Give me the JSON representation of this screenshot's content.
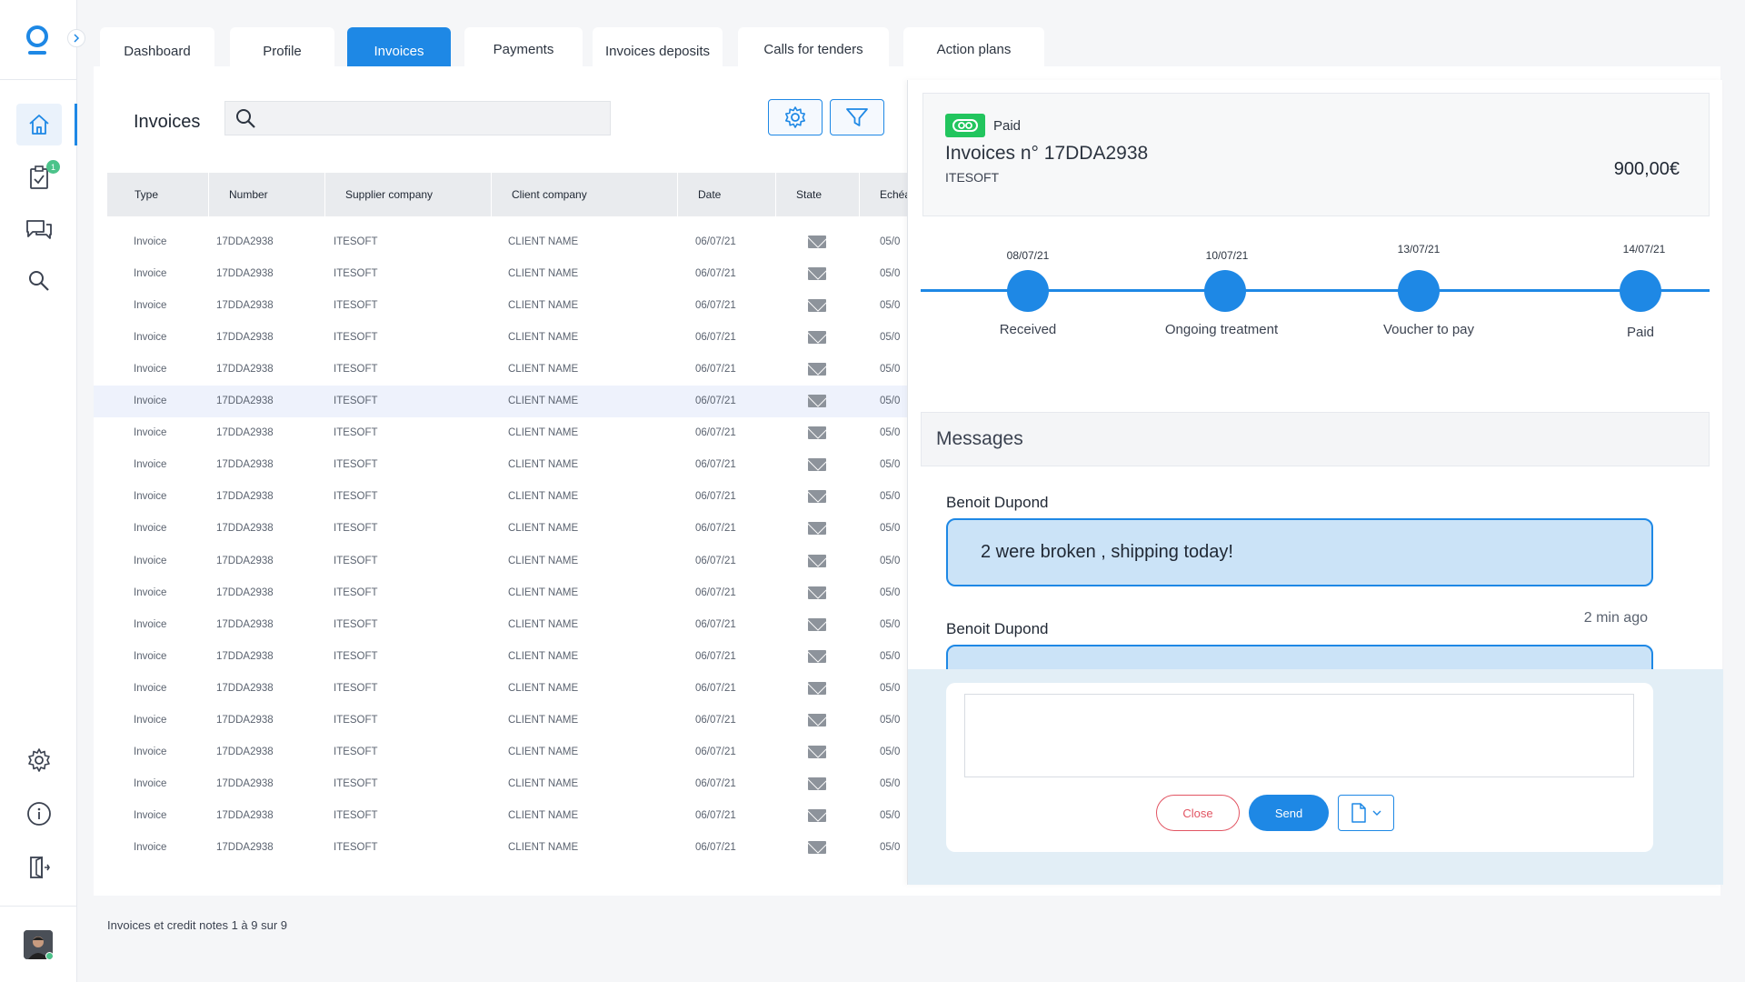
{
  "sidebar": {
    "badge_count": "1",
    "accent": "#1e88e5"
  },
  "tabs": [
    {
      "label": "Dashboard"
    },
    {
      "label": "Profile"
    },
    {
      "label": "Invoices"
    },
    {
      "label": "Payments"
    },
    {
      "label": "Invoices deposits"
    },
    {
      "label": "Calls for tenders"
    },
    {
      "label": "Action plans"
    }
  ],
  "main": {
    "title": "Invoices",
    "search_placeholder": "",
    "footer": "Invoices et credit notes 1 à 9 sur 9"
  },
  "table": {
    "columns": [
      "Type",
      "Number",
      "Supplier company",
      "Client company",
      "Date",
      "State",
      "Echéa"
    ],
    "selected_row": 5,
    "rows": [
      {
        "type": "Invoice",
        "number": "17DDA2938",
        "supplier": "ITESOFT",
        "client": "CLIENT NAME",
        "date": "06/07/21",
        "due": "05/0"
      },
      {
        "type": "Invoice",
        "number": "17DDA2938",
        "supplier": "ITESOFT",
        "client": "CLIENT NAME",
        "date": "06/07/21",
        "due": "05/0"
      },
      {
        "type": "Invoice",
        "number": "17DDA2938",
        "supplier": "ITESOFT",
        "client": "CLIENT NAME",
        "date": "06/07/21",
        "due": "05/0"
      },
      {
        "type": "Invoice",
        "number": "17DDA2938",
        "supplier": "ITESOFT",
        "client": "CLIENT NAME",
        "date": "06/07/21",
        "due": "05/0"
      },
      {
        "type": "Invoice",
        "number": "17DDA2938",
        "supplier": "ITESOFT",
        "client": "CLIENT NAME",
        "date": "06/07/21",
        "due": "05/0"
      },
      {
        "type": "Invoice",
        "number": "17DDA2938",
        "supplier": "ITESOFT",
        "client": "CLIENT NAME",
        "date": "06/07/21",
        "due": "05/0"
      },
      {
        "type": "Invoice",
        "number": "17DDA2938",
        "supplier": "ITESOFT",
        "client": "CLIENT NAME",
        "date": "06/07/21",
        "due": "05/0"
      },
      {
        "type": "Invoice",
        "number": "17DDA2938",
        "supplier": "ITESOFT",
        "client": "CLIENT NAME",
        "date": "06/07/21",
        "due": "05/0"
      },
      {
        "type": "Invoice",
        "number": "17DDA2938",
        "supplier": "ITESOFT",
        "client": "CLIENT NAME",
        "date": "06/07/21",
        "due": "05/0"
      },
      {
        "type": "Invoice",
        "number": "17DDA2938",
        "supplier": "ITESOFT",
        "client": "CLIENT NAME",
        "date": "06/07/21",
        "due": "05/0"
      },
      {
        "type": "Invoice",
        "number": "17DDA2938",
        "supplier": "ITESOFT",
        "client": "CLIENT NAME",
        "date": "06/07/21",
        "due": "05/0"
      },
      {
        "type": "Invoice",
        "number": "17DDA2938",
        "supplier": "ITESOFT",
        "client": "CLIENT NAME",
        "date": "06/07/21",
        "due": "05/0"
      },
      {
        "type": "Invoice",
        "number": "17DDA2938",
        "supplier": "ITESOFT",
        "client": "CLIENT NAME",
        "date": "06/07/21",
        "due": "05/0"
      },
      {
        "type": "Invoice",
        "number": "17DDA2938",
        "supplier": "ITESOFT",
        "client": "CLIENT NAME",
        "date": "06/07/21",
        "due": "05/0"
      },
      {
        "type": "Invoice",
        "number": "17DDA2938",
        "supplier": "ITESOFT",
        "client": "CLIENT NAME",
        "date": "06/07/21",
        "due": "05/0"
      },
      {
        "type": "Invoice",
        "number": "17DDA2938",
        "supplier": "ITESOFT",
        "client": "CLIENT NAME",
        "date": "06/07/21",
        "due": "05/0"
      },
      {
        "type": "Invoice",
        "number": "17DDA2938",
        "supplier": "ITESOFT",
        "client": "CLIENT NAME",
        "date": "06/07/21",
        "due": "05/0"
      },
      {
        "type": "Invoice",
        "number": "17DDA2938",
        "supplier": "ITESOFT",
        "client": "CLIENT NAME",
        "date": "06/07/21",
        "due": "05/0"
      },
      {
        "type": "Invoice",
        "number": "17DDA2938",
        "supplier": "ITESOFT",
        "client": "CLIENT NAME",
        "date": "06/07/21",
        "due": "05/0"
      },
      {
        "type": "Invoice",
        "number": "17DDA2938",
        "supplier": "ITESOFT",
        "client": "CLIENT NAME",
        "date": "06/07/21",
        "due": "05/0"
      }
    ]
  },
  "detail": {
    "status": "Paid",
    "status_color": "#22c55e",
    "title": "Invoices  n° 17DDA2938",
    "company": "ITESOFT",
    "amount": "900,00€",
    "timeline": [
      {
        "date": "08/07/21",
        "label": "Received"
      },
      {
        "date": "10/07/21",
        "label": "Ongoing treatment"
      },
      {
        "date": "13/07/21",
        "label": "Voucher to pay"
      },
      {
        "date": "14/07/21",
        "label": "Paid"
      }
    ],
    "messages_title": "Messages",
    "messages": [
      {
        "author": "Benoit Dupond",
        "text": "2 were broken , shipping today!",
        "time": ""
      },
      {
        "author": "Benoit Dupond",
        "text": "",
        "time": "2 min ago"
      }
    ],
    "compose": {
      "placeholder": "",
      "close_label": "Close",
      "send_label": "Send"
    }
  }
}
